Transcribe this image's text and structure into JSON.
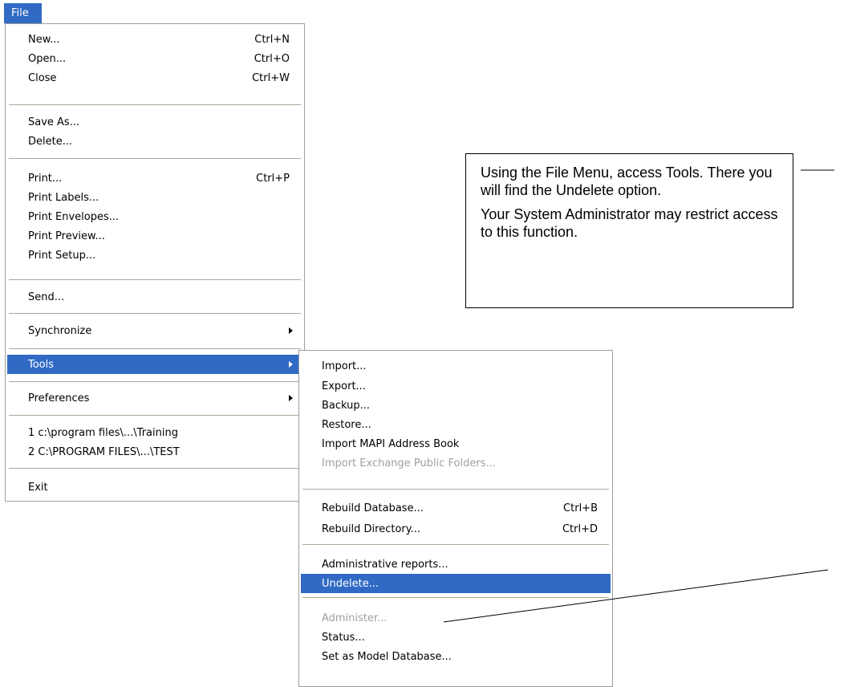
{
  "menubar": {
    "file_label": "File"
  },
  "file_menu": {
    "new_label": "New...",
    "new_shortcut": "Ctrl+N",
    "open_label": "Open...",
    "open_shortcut": "Ctrl+O",
    "close_label": "Close",
    "close_shortcut": "Ctrl+W",
    "save_as_label": "Save As...",
    "delete_label": "Delete...",
    "print_label": "Print...",
    "print_shortcut": "Ctrl+P",
    "print_labels_label": "Print Labels...",
    "print_envelopes_label": "Print Envelopes...",
    "print_preview_label": "Print Preview...",
    "print_setup_label": "Print Setup...",
    "send_label": "Send...",
    "synchronize_label": "Synchronize",
    "tools_label": "Tools",
    "preferences_label": "Preferences",
    "recent_1_label": "1 c:\\program files\\...\\Training",
    "recent_2_label": "2 C:\\PROGRAM FILES\\...\\TEST",
    "exit_label": "Exit"
  },
  "tools_menu": {
    "import_label": "Import...",
    "export_label": "Export...",
    "backup_label": "Backup...",
    "restore_label": "Restore...",
    "import_mapi_label": "Import MAPI Address Book",
    "import_exchange_label": "Import Exchange Public Folders...",
    "rebuild_database_label": "Rebuild Database...",
    "rebuild_database_shortcut": "Ctrl+B",
    "rebuild_directory_label": "Rebuild Directory...",
    "rebuild_directory_shortcut": "Ctrl+D",
    "admin_reports_label": "Administrative reports...",
    "undelete_label": "Undelete...",
    "administer_label": "Administer...",
    "status_label": "Status...",
    "set_model_label": "Set as Model Database..."
  },
  "callout": {
    "paragraph_1": "Using the File Menu, access Tools.  There you will find the Undelete option.",
    "paragraph_2": "Your System Administrator may restrict access to this function."
  },
  "colors": {
    "highlight": "#316ac5",
    "disabled_text": "#a0a0a0"
  }
}
